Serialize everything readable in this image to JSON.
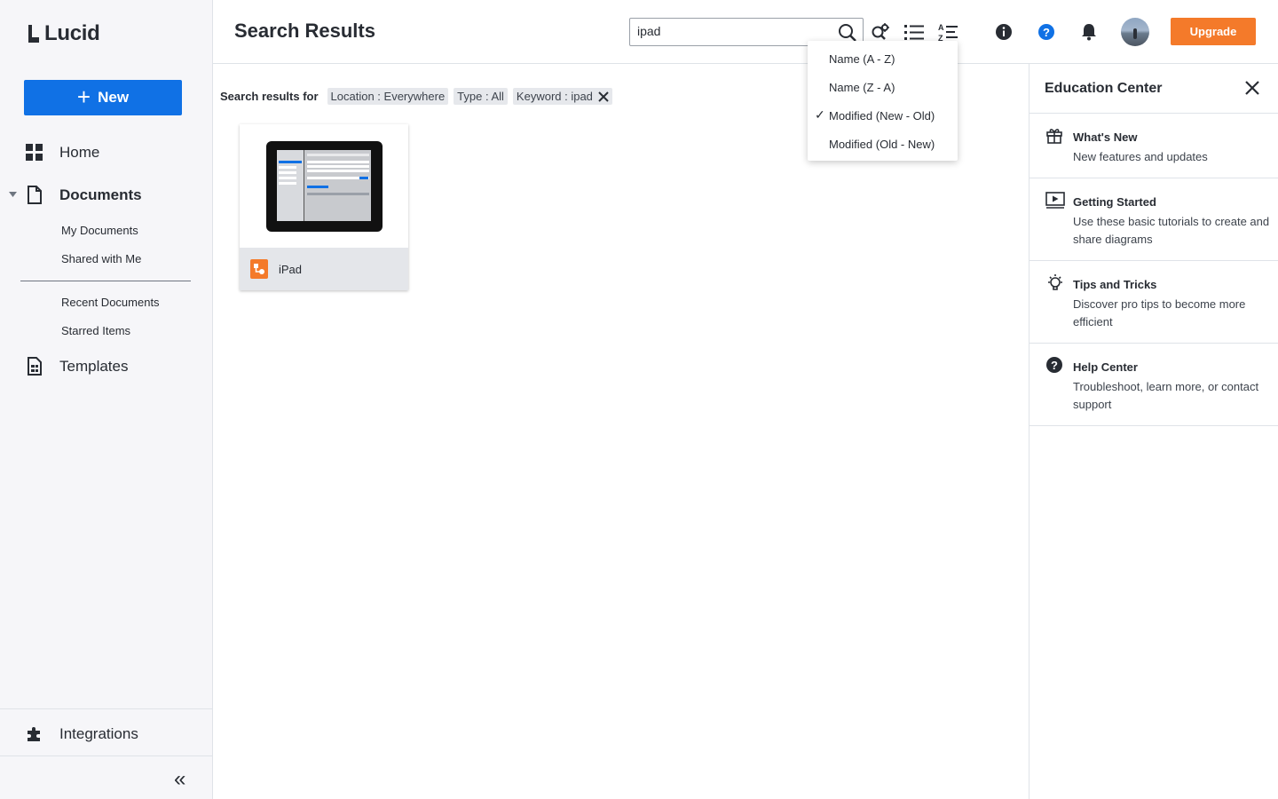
{
  "app": {
    "logo_text": "Lucid"
  },
  "sidebar": {
    "new_label": "New",
    "home_label": "Home",
    "documents_label": "Documents",
    "my_documents_label": "My Documents",
    "shared_with_me_label": "Shared with Me",
    "recent_documents_label": "Recent Documents",
    "starred_items_label": "Starred Items",
    "templates_label": "Templates",
    "integrations_label": "Integrations"
  },
  "header": {
    "title": "Search Results",
    "search_value": "ipad",
    "upgrade_label": "Upgrade",
    "icons": [
      "search-icon",
      "search-settings-icon",
      "list-view-icon",
      "sort-icon",
      "info-icon",
      "help-icon",
      "bell-icon"
    ]
  },
  "results": {
    "label": "Search results for",
    "filters": [
      {
        "text": "Location : Everywhere"
      },
      {
        "text": "Type : All"
      },
      {
        "text": "Keyword : ipad",
        "removable": true
      }
    ],
    "documents": [
      {
        "name": "iPad",
        "icon": "lucidchart-doc-icon"
      }
    ]
  },
  "sort_menu": {
    "items": [
      {
        "label": "Name (A - Z)",
        "selected": false
      },
      {
        "label": "Name (Z - A)",
        "selected": false
      },
      {
        "label": "Modified (New - Old)",
        "selected": true
      },
      {
        "label": "Modified (Old - New)",
        "selected": false
      }
    ],
    "check_glyph": "✓"
  },
  "education_center": {
    "title": "Education Center",
    "items": [
      {
        "title": "What's New",
        "description": "New features and updates",
        "icon": "gift-icon"
      },
      {
        "title": "Getting Started",
        "description": "Use these basic tutorials to create and share diagrams",
        "icon": "video-icon"
      },
      {
        "title": "Tips and Tricks",
        "description": "Discover pro tips to become more efficient",
        "icon": "lightbulb-icon"
      },
      {
        "title": "Help Center",
        "description": "Troubleshoot, learn more, or contact support",
        "icon": "question-circle-icon"
      }
    ]
  },
  "colors": {
    "accent_blue": "#1071e5",
    "upgrade_orange": "#f47a2a",
    "doc_icon_orange": "#f47a2a",
    "sidebar_bg": "#f6f6f9"
  }
}
